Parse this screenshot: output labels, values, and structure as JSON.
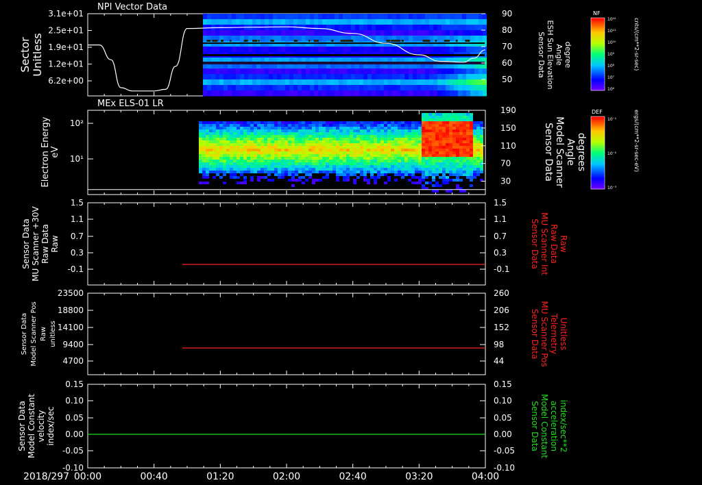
{
  "date_label": "2018/297",
  "time_ticks": [
    "00:00",
    "00:40",
    "01:20",
    "02:00",
    "02:40",
    "03:20",
    "04:00"
  ],
  "colors": {
    "left_axis": "#ffffff",
    "red_series": "#ff2020",
    "green_series": "#20e020"
  },
  "chart_data": [
    {
      "type": "heatmap",
      "title": "NPI Vector Data",
      "ylabel": [
        "Sector",
        "Unitless"
      ],
      "yticks": [
        "3.1e+01",
        "2.5e+01",
        "1.9e+01",
        "1.2e+01",
        "6.2e+00"
      ],
      "right_ylabel": [
        "Sensor Data",
        "ESH Sun Elevation",
        "Angle",
        "degree"
      ],
      "right_yticks": [
        "90",
        "80",
        "70",
        "60",
        "50"
      ],
      "right_ylim": [
        40,
        90
      ],
      "colorbar": {
        "label": "NF",
        "units": "cnts/(cm**2-sr-sec)",
        "ticks": [
          "10¹²",
          "10¹¹",
          "10¹⁰",
          "10⁹",
          "10⁸",
          "10⁷",
          "10⁶"
        ]
      },
      "line_series": {
        "name": "Sensor Data ESH Sun Elevation Angle",
        "x": [
          "00:00",
          "00:07",
          "00:14",
          "00:20",
          "00:27",
          "00:33",
          "00:40",
          "00:47",
          "00:53",
          "01:00",
          "01:20",
          "01:40",
          "02:00",
          "02:20",
          "02:40",
          "03:00",
          "03:20",
          "03:33",
          "03:47",
          "03:53",
          "04:00"
        ],
        "values": [
          71,
          71,
          62,
          45,
          43,
          43,
          43,
          44,
          58,
          81,
          81.5,
          81.8,
          82,
          81,
          78,
          72,
          65,
          61,
          60.5,
          63,
          68
        ]
      }
    },
    {
      "type": "heatmap",
      "title": "MEx ELS-01 LR",
      "ylabel": [
        "Electron Energy",
        "eV"
      ],
      "yticks": [
        "10²",
        "10¹"
      ],
      "right_ylabel": [
        "Sensor Data",
        "Model Scanner",
        "Angle",
        "degrees"
      ],
      "right_yticks": [
        "190",
        "150",
        "110",
        "70",
        "30"
      ],
      "right_ylim": [
        0,
        190
      ],
      "colorbar": {
        "label": "DEF",
        "units": "ergs/(cm**2-sr-sec-eV)",
        "ticks": [
          "10⁻¹",
          "10⁻²",
          "10⁻³"
        ]
      },
      "line_series": {
        "name": "Sensor Data Model Scanner Angle",
        "x": [
          "00:00",
          "04:00"
        ],
        "values": [
          2,
          2
        ]
      }
    },
    {
      "type": "line",
      "ylabel": [
        "Sensor Data",
        "MU Scanner +30V",
        "Raw Data",
        "Raw"
      ],
      "yticks": [
        "1.5",
        "1.1",
        "0.7",
        "0.3",
        "-0.1"
      ],
      "right_ylabel": [
        "Sensor Data",
        "MU Scanner Int",
        "Raw Data",
        "Raw"
      ],
      "right_yticks": [
        "1.5",
        "1.1",
        "0.7",
        "0.3",
        "-0.1"
      ],
      "ylim": [
        -0.3,
        1.5
      ],
      "series": [
        {
          "name": "Sensor Data MU Scanner Int Raw Data",
          "x": [
            "00:57",
            "04:00"
          ],
          "values": [
            0.0,
            0.0
          ]
        }
      ]
    },
    {
      "type": "line",
      "ylabel": [
        "Sensor Data",
        "Model Scanner Pos",
        "Raw",
        "unitless"
      ],
      "yticks": [
        "23500",
        "18800",
        "14100",
        "9400",
        "4700"
      ],
      "right_ylabel": [
        "Sensor Data",
        "MU Scanner Pos",
        "Telemetry",
        "Unitless"
      ],
      "right_yticks": [
        "260",
        "206",
        "152",
        "98",
        "44"
      ],
      "ylim": [
        0,
        23500
      ],
      "right_ylim": [
        0,
        260
      ],
      "series": [
        {
          "name": "Sensor Data MU Scanner Pos Telemetry",
          "x": [
            "00:57",
            "04:00"
          ],
          "values": [
            80,
            80
          ]
        }
      ]
    },
    {
      "type": "line",
      "ylabel": [
        "Sensor Data",
        "Model Constant",
        "velocity",
        "index/sec"
      ],
      "yticks": [
        "0.15",
        "0.10",
        "0.05",
        "0.00",
        "-0.05",
        "-0.10"
      ],
      "right_ylabel": [
        "Sensor Data",
        "Model Constant",
        "acceleration",
        "index/sec**2"
      ],
      "right_yticks": [
        "0.15",
        "0.10",
        "0.05",
        "0.00",
        "-0.05",
        "-0.10"
      ],
      "ylim": [
        -0.1,
        0.15
      ],
      "series": [
        {
          "name": "Sensor Data Model Constant acceleration",
          "x": [
            "00:00",
            "04:00"
          ],
          "values": [
            0.0,
            0.0
          ]
        }
      ]
    }
  ]
}
